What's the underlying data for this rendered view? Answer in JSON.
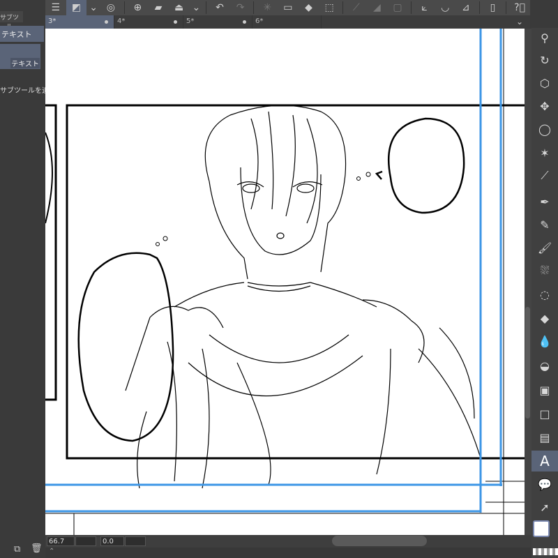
{
  "left_panel": {
    "tab_label": "サブツール",
    "selected_group": "テキスト",
    "item_label": "テキスト",
    "add_label": "サブツールを追加する"
  },
  "toolbar": {
    "items": [
      "menu-icon",
      "selection-icon",
      "chevron-down-icon",
      "spiral-icon",
      "new-icon",
      "open-icon",
      "save-icon",
      "chevron-down-icon",
      "undo-icon",
      "redo-icon",
      "busy-icon",
      "clear-icon",
      "fill-icon",
      "transform-icon",
      "deselect-icon",
      "mask-icon",
      "crop-icon",
      "ruler-icon",
      "perspective-icon",
      "special-ruler-icon",
      "device-icon",
      "help-icon"
    ]
  },
  "tabs": [
    {
      "label": "3*",
      "active": true
    },
    {
      "label": "4*"
    },
    {
      "label": "5*"
    },
    {
      "label": "6*"
    }
  ],
  "status": {
    "zoom": "66.7",
    "rotation": "0.0"
  },
  "tools": [
    "zoom",
    "rotate",
    "object",
    "move",
    "lasso",
    "magic-wand",
    "eyedropper",
    "pen",
    "pencil",
    "brush",
    "airbrush",
    "decoration",
    "eraser",
    "blend",
    "fill",
    "gradient",
    "figure",
    "frame",
    "text",
    "balloon",
    "correct-line"
  ],
  "active_tool": "text",
  "text_tool_glyph": "A",
  "colors": {
    "accent": "#5a6478",
    "guide": "#3c96e6"
  }
}
